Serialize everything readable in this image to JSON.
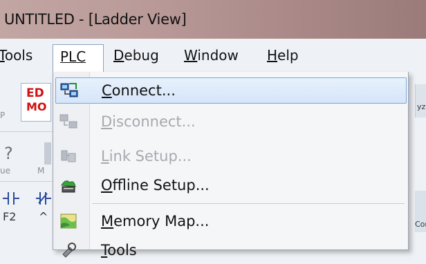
{
  "window": {
    "title": "UNTITLED - [Ladder View]"
  },
  "menubar": {
    "items": [
      {
        "name": "tools",
        "label_rest": "ools",
        "underline": "T",
        "active": false
      },
      {
        "name": "plc",
        "label": "PLC",
        "underline_index": 0,
        "active": true
      },
      {
        "name": "debug",
        "label_rest": "ebug",
        "underline": "D",
        "active": false
      },
      {
        "name": "window",
        "label_rest": "indow",
        "underline": "W",
        "active": false
      },
      {
        "name": "help",
        "label_rest": "elp",
        "underline": "H",
        "active": false
      }
    ]
  },
  "toolbar": {
    "edit_line1": "ED",
    "edit_line2": "MO",
    "partial_p": "P",
    "partial_q": "?",
    "partial_ue": "ue",
    "partial_m": "M",
    "partial_f2": "F2",
    "partial_caret": "^",
    "right_partial1": "yz",
    "right_partial2": "Cor"
  },
  "plc_menu": {
    "items": [
      {
        "name": "connect",
        "first": "C",
        "rest": "onnect...",
        "enabled": true,
        "highlighted": true
      },
      {
        "name": "disconnect",
        "first": "D",
        "rest": "isconnect...",
        "enabled": false,
        "highlighted": false
      },
      {
        "name": "link-setup",
        "first": "L",
        "rest": "ink Setup...",
        "enabled": false,
        "highlighted": false
      },
      {
        "name": "offline-setup",
        "first": "O",
        "rest": "ffline Setup...",
        "enabled": true,
        "highlighted": false
      },
      {
        "name": "memory-map",
        "first": "M",
        "rest": "emory Map...",
        "enabled": true,
        "highlighted": false
      },
      {
        "name": "tools",
        "first": "T",
        "rest": "ools",
        "enabled": true,
        "highlighted": false
      }
    ]
  },
  "colors": {
    "highlight_border": "#7aa6da",
    "disabled_text": "#a6a9ae",
    "edit_red": "#d01010"
  }
}
